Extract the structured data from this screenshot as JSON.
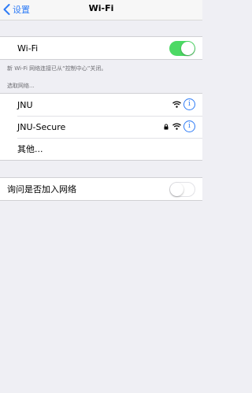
{
  "navbar": {
    "back_label": "设置",
    "title": "Wi-Fi"
  },
  "wifi_toggle": {
    "label": "Wi-Fi",
    "state": "on"
  },
  "wifi_note": "新 Wi-Fi 网络连接已从“控制中心”关闭。",
  "networks_header": "选取网络...",
  "networks": [
    {
      "name": "JNU",
      "secured": false,
      "icon": "wifi-icon",
      "info_icon": "info-icon"
    },
    {
      "name": "JNU-Secure",
      "secured": true,
      "icon": "wifi-icon",
      "info_icon": "info-icon"
    }
  ],
  "other_label": "其他...",
  "ask_join": {
    "label": "询问是否加入网络",
    "state": "off"
  },
  "colors": {
    "accent": "#2f7cf6",
    "toggle_on": "#4cd964",
    "background": "#efeff4"
  }
}
